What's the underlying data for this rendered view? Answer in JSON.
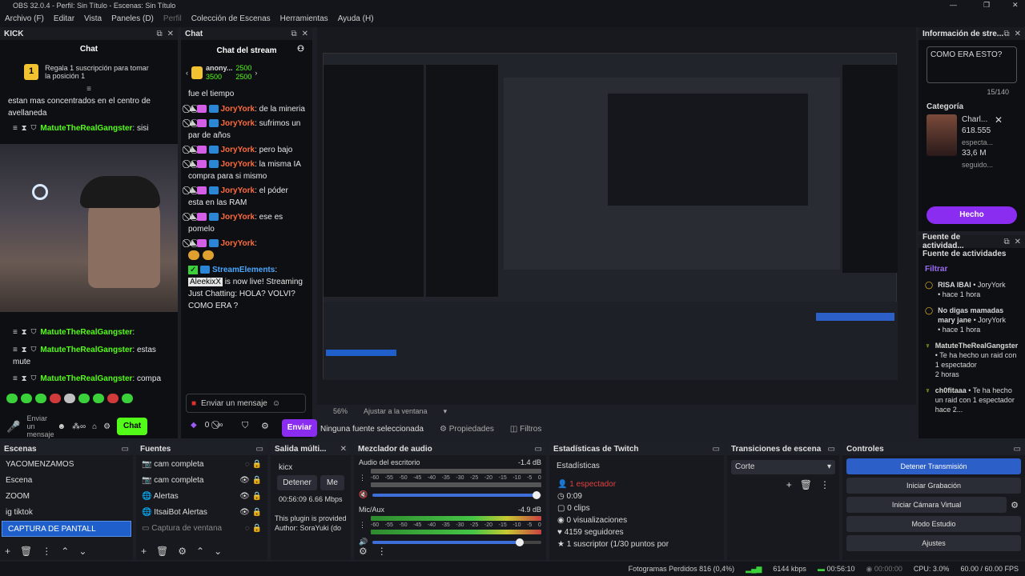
{
  "window": {
    "title": "OBS 32.0.4 - Perfil: Sin Título - Escenas: Sin Título"
  },
  "menu": [
    {
      "label": "Archivo (F)",
      "disabled": false
    },
    {
      "label": "Editar",
      "disabled": false
    },
    {
      "label": "Vista",
      "disabled": false
    },
    {
      "label": "Paneles (D)",
      "disabled": false
    },
    {
      "label": "Perfil",
      "disabled": true
    },
    {
      "label": "Colección de Escenas",
      "disabled": false
    },
    {
      "label": "Herramientas",
      "disabled": false
    },
    {
      "label": "Ayuda (H)",
      "disabled": false
    }
  ],
  "kick": {
    "dock_title": "KICK",
    "header": "Chat",
    "promo": "Regala 1 suscripción para tomar la posición 1",
    "promo_rank": "1",
    "message1": "estan mas concentrados en el centro de avellaneda",
    "user": "MatuteTheRealGangster",
    "msg_sisi": "sisi",
    "msg_estas": "estas mute",
    "msg_compa": "compa",
    "input_placeholder": "Enviar un mensaje",
    "send_label": "Chat"
  },
  "stream_chat": {
    "dock_title": "Chat",
    "header": "Chat del stream",
    "top_user": "anony...",
    "top_points": "3500",
    "pts_a": "2500",
    "pts_b": "2500",
    "msg_fue": "fue el tiempo",
    "user_jory": "JoryYork",
    "msgs": [
      {
        "text": "de la mineria"
      },
      {
        "text": "sufrimos un par de años"
      },
      {
        "text": "pero bajo"
      },
      {
        "text": "la misma IA compra para si mismo"
      },
      {
        "text": "el póder esta en las RAM"
      },
      {
        "text": "ese es pomelo"
      }
    ],
    "se_user": "StreamElements",
    "se_name": "AleekixX",
    "se_text": "is now live! Streaming Just Chatting: HOLA? VOLVI? COMO ERA ?",
    "input_placeholder": "Enviar un mensaje",
    "count": "0",
    "send_label": "Enviar"
  },
  "preview": {
    "zoom": "56%",
    "fit_label": "Ajustar a la ventana"
  },
  "source_bar": {
    "no_source": "Ninguna fuente seleccionada",
    "properties": "Propiedades",
    "filters": "Filtros"
  },
  "info": {
    "dock_title": "Información de stre...",
    "title_value": "COMO ERA ESTO?",
    "char_count": "15/140",
    "category_label": "Categoría",
    "category_name": "Charl...",
    "viewers": "618.555",
    "viewers_label": "especta...",
    "followers": "33,6 M",
    "followers_label": "seguido...",
    "done_label": "Hecho"
  },
  "feed": {
    "dock_title": "Fuente de actividad...",
    "header": "Fuente de actividades",
    "filter": "Filtrar",
    "items": [
      {
        "title": "RISA IBAI",
        "user": "JoryYork",
        "time": "hace 1 hora"
      },
      {
        "title": "No digas mamadas mary jane",
        "user": "JoryYork",
        "time": "hace 1 hora"
      },
      {
        "title": "MatuteTheRealGangster",
        "user": "",
        "time": "Te ha hecho un raid con 1 espectador",
        "time2": "2 horas"
      },
      {
        "title": "ch0fitaaa",
        "user": "",
        "time": "Te ha hecho un raid con 1 espectador",
        "time2": "hace 2..."
      }
    ]
  },
  "scenes": {
    "title": "Escenas",
    "items": [
      "YACOMENZAMOS",
      "Escena",
      "ZOOM",
      "ig tiktok",
      "CAPTURA DE PANTALL"
    ],
    "selected": 4
  },
  "sources": {
    "title": "Fuentes",
    "items": [
      "cam completa",
      "cam completa",
      "Alertas",
      "ItsaiBot Alertas",
      "Captura de ventana"
    ]
  },
  "multi": {
    "title": "Salida múlti...",
    "account": "kicx",
    "stop_label": "Detener",
    "more_label": "Me",
    "stats": "00:56:09  6.66 Mbps",
    "notice": "This plugin is provided",
    "author": "Author: SoraYuki (do"
  },
  "mixer": {
    "title": "Mezclador de audio",
    "channels": [
      {
        "name": "Audio del escritorio",
        "db": "-1.4 dB",
        "level": 0.97
      },
      {
        "name": "Mic/Aux",
        "db": "-4.9 dB",
        "level": 0.87
      }
    ],
    "scale": [
      "-60",
      "-55",
      "-50",
      "-45",
      "-40",
      "-35",
      "-30",
      "-25",
      "-20",
      "-15",
      "-10",
      "-5",
      "0"
    ]
  },
  "twitch": {
    "title": "Estadísticas de Twitch",
    "header": "Estadísticas",
    "viewers": "1 espectador",
    "uptime": "0:09",
    "clips": "0 clips",
    "views": "0 visualizaciones",
    "followers": "4159 seguidores",
    "subs": "1 suscriptor (1/30 puntos por"
  },
  "transitions": {
    "title": "Transiciones de escena",
    "selected": "Corte"
  },
  "controls": {
    "title": "Controles",
    "buttons": [
      "Detener Transmisión",
      "Iniciar Grabación",
      "Iniciar Cámara Virtual",
      "Modo Estudio",
      "Ajustes"
    ]
  },
  "status": {
    "dropped": "Fotogramas Perdidos 816 (0,4%)",
    "bitrate": "6144 kbps",
    "live_time": "00:56:10",
    "rec_time": "00:00:00",
    "cpu": "CPU: 3.0%",
    "fps": "60.00 / 60.00 FPS"
  },
  "colors": {
    "accent": "#53fc18",
    "purple": "#8b2df0",
    "blue": "#2d5fc9"
  }
}
